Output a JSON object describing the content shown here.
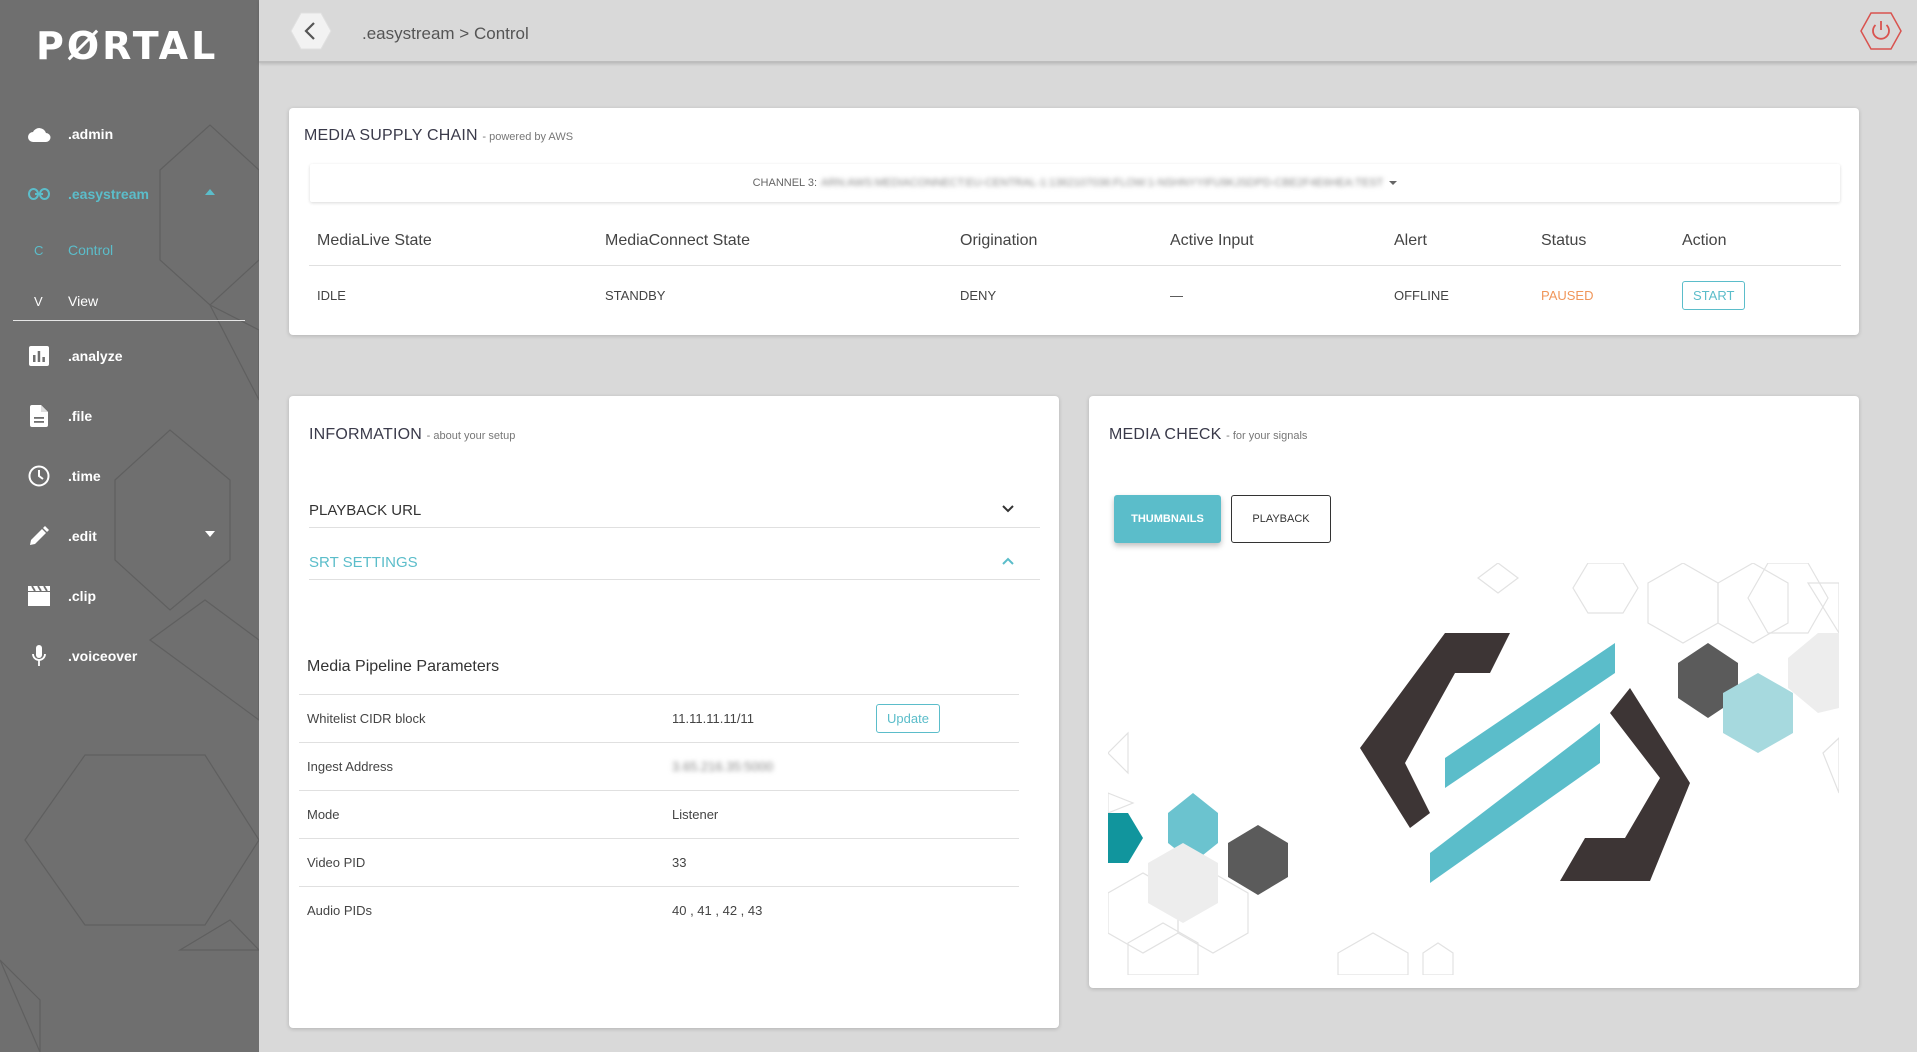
{
  "sidebar": {
    "logo": "PØRTAL",
    "items": [
      {
        "label": ".admin",
        "icon": "cloud-icon"
      },
      {
        "label": ".easystream",
        "icon": "link-icon",
        "expanded": true
      },
      {
        "label": ".analyze",
        "icon": "bar-chart-icon"
      },
      {
        "label": ".file",
        "icon": "document-icon"
      },
      {
        "label": ".time",
        "icon": "clock-icon"
      },
      {
        "label": ".edit",
        "icon": "pencil-icon"
      },
      {
        "label": ".clip",
        "icon": "clapperboard-icon"
      },
      {
        "label": ".voiceover",
        "icon": "microphone-icon"
      }
    ],
    "subitems": [
      {
        "letter": "C",
        "label": "Control",
        "active": true
      },
      {
        "letter": "V",
        "label": "View"
      }
    ]
  },
  "header": {
    "breadcrumb": ".easystream > Control"
  },
  "supply_chain": {
    "title": "MEDIA SUPPLY CHAIN",
    "subtitle": "- powered by AWS",
    "channel_label": "CHANNEL 3:",
    "channel_value": "ARN:AWS:MEDIACONNECT:EU-CENTRAL-1:1362107036:FLOW:1-NSHNYYIFU9KJSDPD-CBE2F4E6HEA:TEST",
    "columns": [
      "MediaLive State",
      "MediaConnect State",
      "Origination",
      "Active Input",
      "Alert",
      "Status",
      "Action"
    ],
    "row": {
      "medialive": "IDLE",
      "mediaconnect": "STANDBY",
      "origination": "DENY",
      "active_input": "—",
      "alert": "OFFLINE",
      "status": "PAUSED",
      "action": "START"
    }
  },
  "information": {
    "title": "INFORMATION",
    "subtitle": "- about your setup",
    "accordions": [
      {
        "label": "PLAYBACK URL",
        "open": false
      },
      {
        "label": "SRT SETTINGS",
        "open": true
      }
    ],
    "params_title": "Media Pipeline Parameters",
    "params": [
      {
        "key": "Whitelist CIDR block",
        "value": "11.11.11.11/11",
        "action": "Update"
      },
      {
        "key": "Ingest Address",
        "value": "3.65.216.35:5000"
      },
      {
        "key": "Mode",
        "value": "Listener"
      },
      {
        "key": "Video PID",
        "value": "33"
      },
      {
        "key": "Audio PIDs",
        "value": "40 , 41 , 42 , 43"
      }
    ]
  },
  "media_check": {
    "title": "MEDIA CHECK",
    "subtitle": "- for your signals",
    "thumbnails_label": "THUMBNAILS",
    "playback_label": "PLAYBACK"
  },
  "colors": {
    "accent": "#5bbdca",
    "sidebar": "#6f6f6f",
    "paused": "#f0965a",
    "power": "#d9534f"
  }
}
